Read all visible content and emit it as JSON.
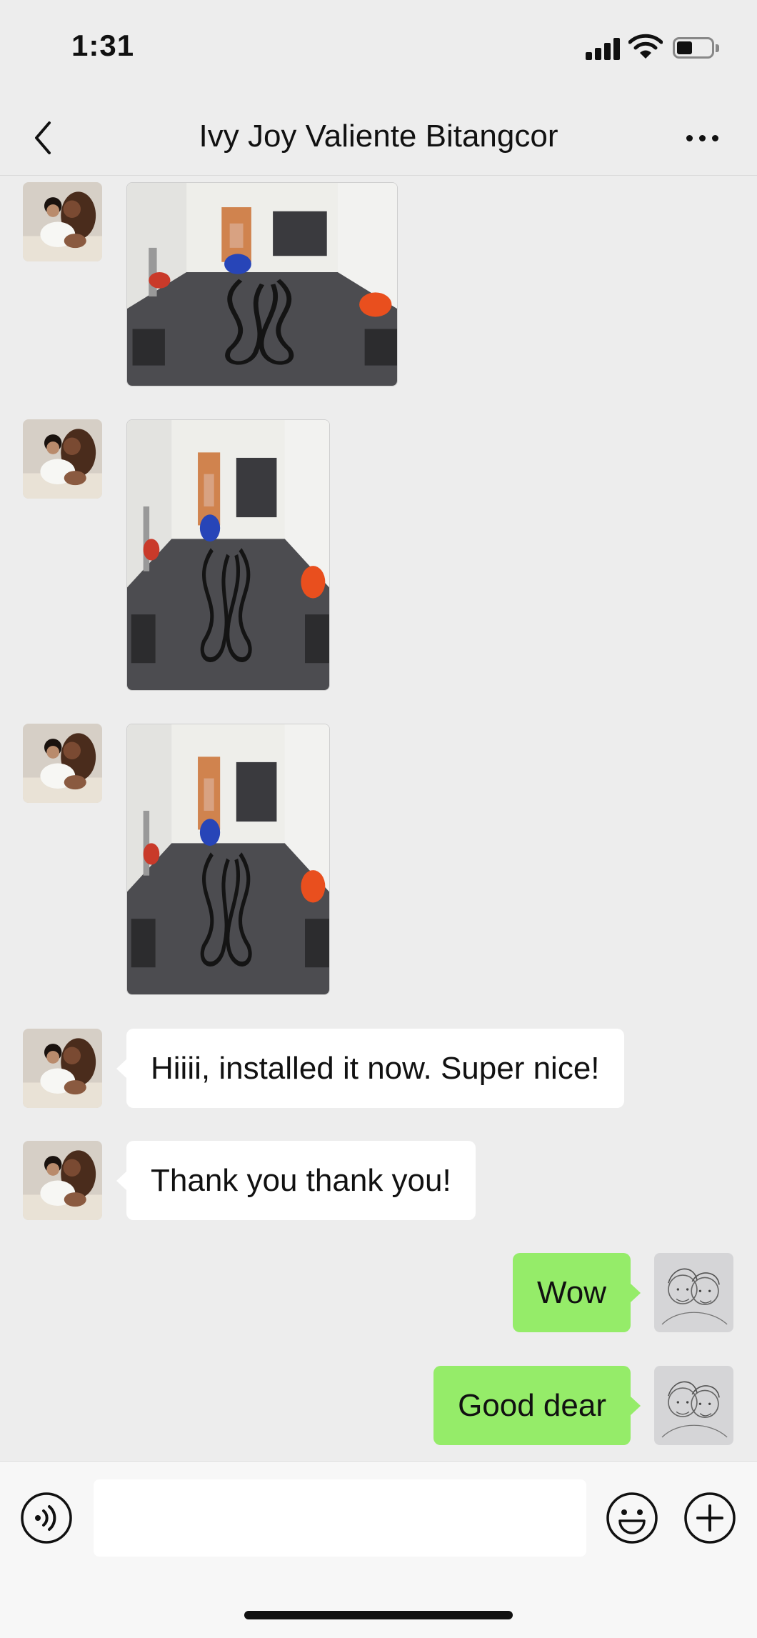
{
  "status_bar": {
    "time": "1:31",
    "icons": [
      "cellular-signal-icon",
      "wifi-icon",
      "battery-icon"
    ]
  },
  "header": {
    "title": "Ivy Joy Valiente Bitangcor",
    "back_icon": "chevron-left-icon",
    "more_icon": "more-dots-icon"
  },
  "messages": [
    {
      "type": "image",
      "from": "contact",
      "content": "photo of home gym with battle ropes"
    },
    {
      "type": "image",
      "from": "contact",
      "content": "photo of home gym with battle ropes"
    },
    {
      "type": "image",
      "from": "contact",
      "content": "photo of home gym with battle ropes"
    },
    {
      "type": "text",
      "from": "contact",
      "text": "Hiiii, installed it now. Super nice!"
    },
    {
      "type": "text",
      "from": "contact",
      "text": "Thank you thank you!"
    },
    {
      "type": "text",
      "from": "me",
      "text": "Wow"
    },
    {
      "type": "text",
      "from": "me",
      "text": "Good dear"
    }
  ],
  "input_bar": {
    "input_value": "",
    "icons": [
      "voice-icon",
      "emoji-icon",
      "plus-icon"
    ]
  },
  "colors": {
    "background": "#ededed",
    "incoming_bubble": "#ffffff",
    "outgoing_bubble": "#95ec69",
    "input_bar": "#f7f7f7"
  }
}
